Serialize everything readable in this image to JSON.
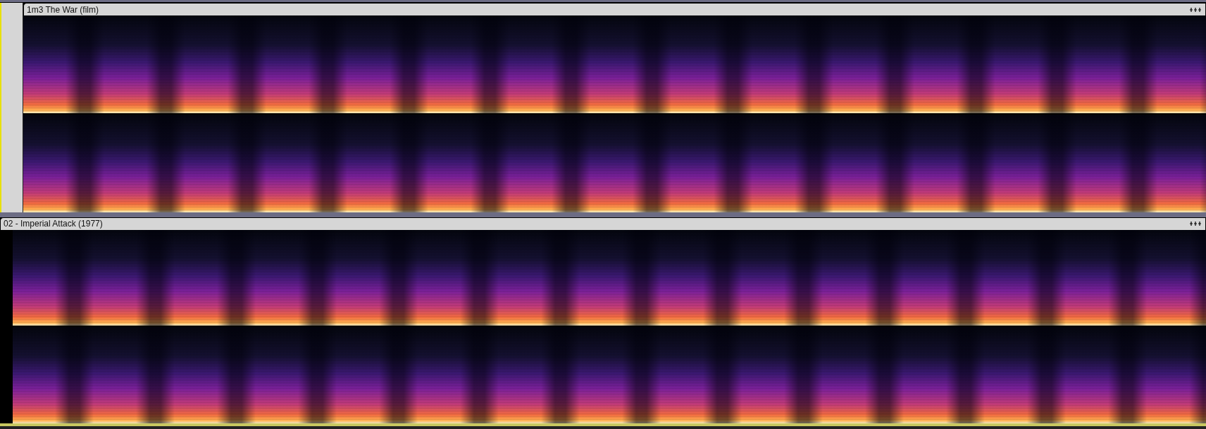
{
  "tracks": [
    {
      "clip_name": "1m3 The War (film)"
    },
    {
      "clip_name": "02 - Imperial Attack (1977)"
    }
  ]
}
